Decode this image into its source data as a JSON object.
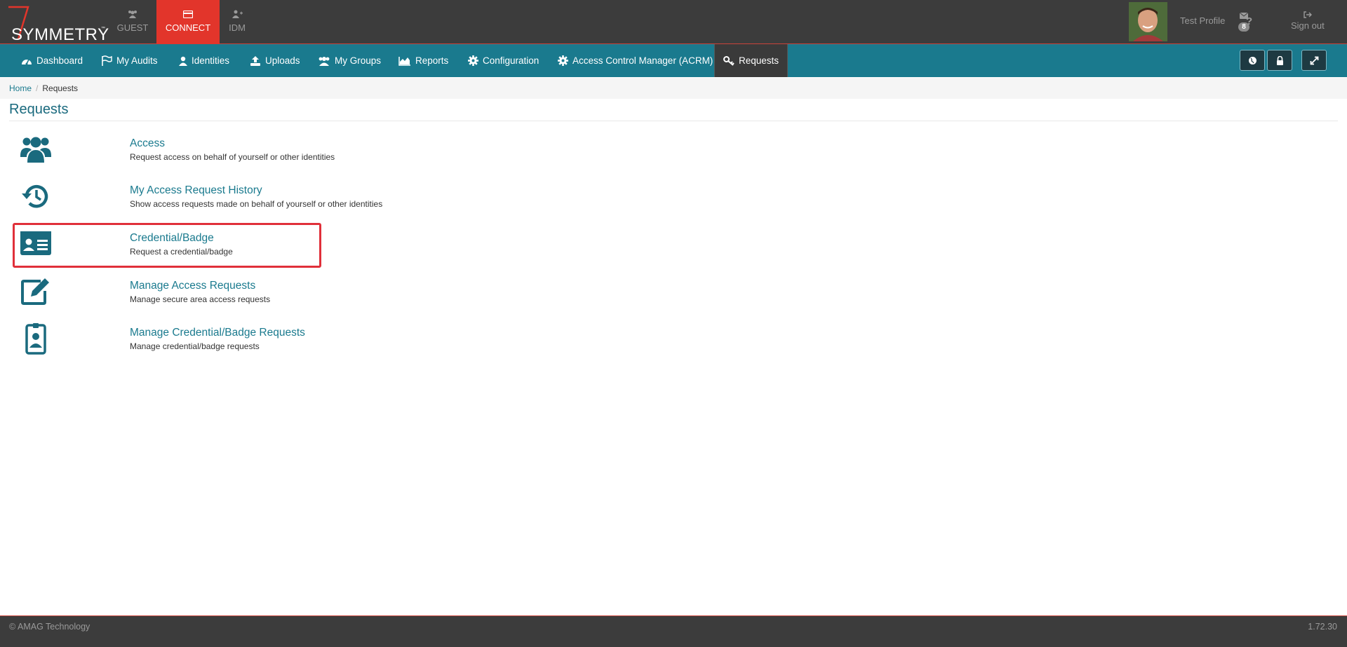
{
  "app": {
    "logo_text": "SYMMETRY",
    "logo_tm": "™",
    "modules": [
      {
        "label": "GUEST",
        "icon": "users-icon"
      },
      {
        "label": "CONNECT",
        "icon": "card-icon"
      },
      {
        "label": "IDM",
        "icon": "user-plus-icon"
      }
    ],
    "profile_label": "Test Profile",
    "mail_count": "8",
    "help_label": "?",
    "signout_label": "Sign out"
  },
  "nav": {
    "items": [
      {
        "label": "Dashboard",
        "icon": "dashboard-icon"
      },
      {
        "label": "My Audits",
        "icon": "flag-icon"
      },
      {
        "label": "Identities",
        "icon": "user-icon"
      },
      {
        "label": "Uploads",
        "icon": "upload-icon"
      },
      {
        "label": "My Groups",
        "icon": "group-icon"
      },
      {
        "label": "Reports",
        "icon": "area-chart-icon"
      },
      {
        "label": "Configuration",
        "icon": "gear-icon"
      },
      {
        "label": "Access Control Manager (ACRM)",
        "icon": "gear-icon"
      },
      {
        "label": "Requests",
        "icon": "key-icon"
      }
    ],
    "active": "Requests",
    "right_buttons": [
      "globe-icon",
      "lock-icon",
      "expand-icon"
    ]
  },
  "breadcrumb": {
    "home": "Home",
    "sep": "/",
    "current": "Requests"
  },
  "page": {
    "title": "Requests",
    "items": [
      {
        "title": "Access",
        "desc": "Request access on behalf of yourself or other identities",
        "icon": "users-icon"
      },
      {
        "title": "My Access Request History",
        "desc": "Show access requests made on behalf of yourself or other identities",
        "icon": "history-icon"
      },
      {
        "title": "Credential/Badge",
        "desc": "Request a credential/badge",
        "icon": "id-card-icon"
      },
      {
        "title": "Manage Access Requests",
        "desc": "Manage secure area access requests",
        "icon": "edit-icon"
      },
      {
        "title": "Manage Credential/Badge Requests",
        "desc": "Manage credential/badge requests",
        "icon": "badge-icon"
      }
    ]
  },
  "footer": {
    "copyright": "© AMAG Technology",
    "version": "1.72.30"
  },
  "colors": {
    "topbar": "#3c3c3c",
    "accent": "#e2352b",
    "nav": "#1a7a8e",
    "highlight": "#e0303a"
  }
}
